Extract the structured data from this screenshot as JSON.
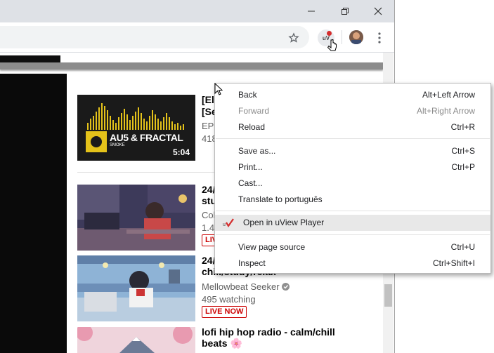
{
  "menu": {
    "items": [
      {
        "label": "Back",
        "shortcut": "Alt+Left Arrow"
      },
      {
        "label": "Forward",
        "shortcut": "Alt+Right Arrow"
      },
      {
        "label": "Reload",
        "shortcut": "Ctrl+R"
      },
      {
        "label": "Save as...",
        "shortcut": "Ctrl+S"
      },
      {
        "label": "Print...",
        "shortcut": "Ctrl+P"
      },
      {
        "label": "Cast..."
      },
      {
        "label": "Translate to português"
      },
      {
        "label": "Open in uView Player"
      },
      {
        "label": "View page source",
        "shortcut": "Ctrl+U"
      },
      {
        "label": "Inspect",
        "shortcut": "Ctrl+Shift+I"
      }
    ]
  },
  "videos": [
    {
      "title1": "[Ele",
      "title2": "[Se",
      "meta1": "EPS",
      "meta2": "418",
      "duration": "5:04",
      "thumb_brand": "AU5 & FRACTAL",
      "thumb_sub": "SMOKE"
    },
    {
      "title1": "24/",
      "title2": "stu",
      "meta1": "Col",
      "meta2": "1.4",
      "badge": "LIVE"
    },
    {
      "title1": "24/",
      "title2": "chill/study/relax",
      "channel": "Mellowbeat Seeker",
      "watching": "495 watching",
      "badge": "LIVE NOW"
    },
    {
      "title1": "lofi hip hop radio - calm/chill",
      "title2": "beats",
      "emoji": "🌸"
    }
  ],
  "extension_icon_text": "uV",
  "colors": {
    "accent_red": "#cc0000",
    "titlebar": "#dee1e6",
    "menu_highlight": "#e8e8e8",
    "uview_check": "#d42c2c"
  }
}
